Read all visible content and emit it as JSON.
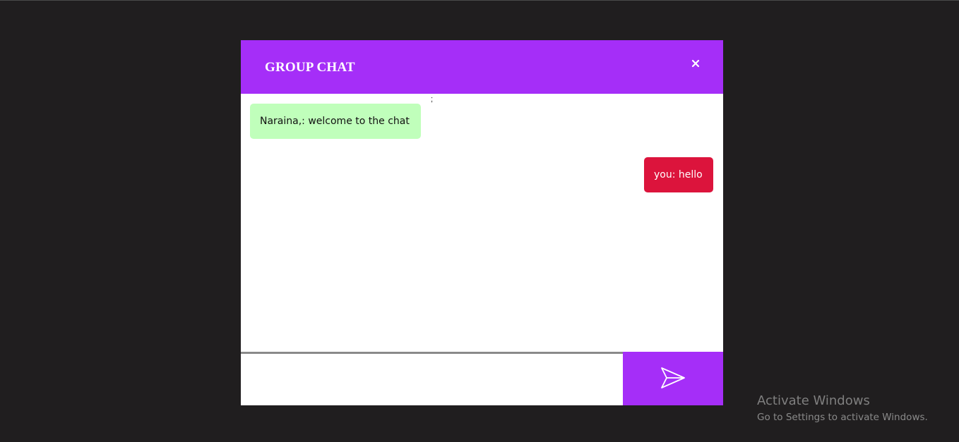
{
  "chat": {
    "title": "GROUP CHAT",
    "close_icon": "close-icon",
    "stray_text": ";",
    "messages": [
      {
        "sender": "Naraina,",
        "text": "Naraina,: welcome to the chat",
        "direction": "incoming",
        "color": "#c0ffbb"
      },
      {
        "sender": "you",
        "text": "you: hello",
        "direction": "outgoing",
        "color": "#dc143c"
      }
    ],
    "input": {
      "value": "",
      "placeholder": ""
    },
    "send_icon": "send-icon"
  },
  "colors": {
    "accent": "#a52ef8",
    "background": "#201e1f"
  },
  "watermark": {
    "title": "Activate Windows",
    "subtitle": "Go to Settings to activate Windows."
  }
}
